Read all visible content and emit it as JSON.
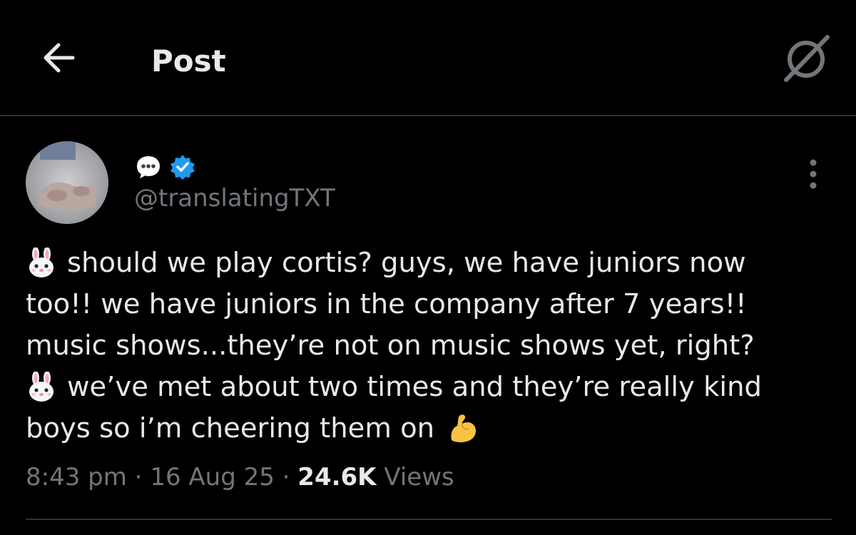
{
  "header": {
    "title": "Post",
    "back_icon": "arrow-left-icon",
    "grok_icon": "grok-icon"
  },
  "author": {
    "display_name_icon": "speech-bubble-icon",
    "verified_icon": "verified-badge-icon",
    "handle": "@translatingTXT",
    "more_icon": "more-vertical-icon"
  },
  "post": {
    "lines": [
      "should we play cortis? guys, we have juniors now",
      "too!! we have juniors in the company after 7 years!!",
      "music shows...they’re not on music shows yet, right?",
      "we’ve met about two times and they’re really kind",
      "boys so i’m cheering them on"
    ],
    "line_icons": [
      "rabbit-face-icon",
      "",
      "",
      "rabbit-face-icon",
      ""
    ],
    "end_icon": "flexed-biceps-icon"
  },
  "meta": {
    "time": "8:43 pm",
    "sep1": " · ",
    "date": "16 Aug 25",
    "sep2": " · ",
    "views_count": "24.6K",
    "views_label": " Views"
  },
  "colors": {
    "background": "#000000",
    "text": "#e7e9ea",
    "muted": "#71767b",
    "verified": "#1d9bf0",
    "divider": "#2f3336"
  }
}
